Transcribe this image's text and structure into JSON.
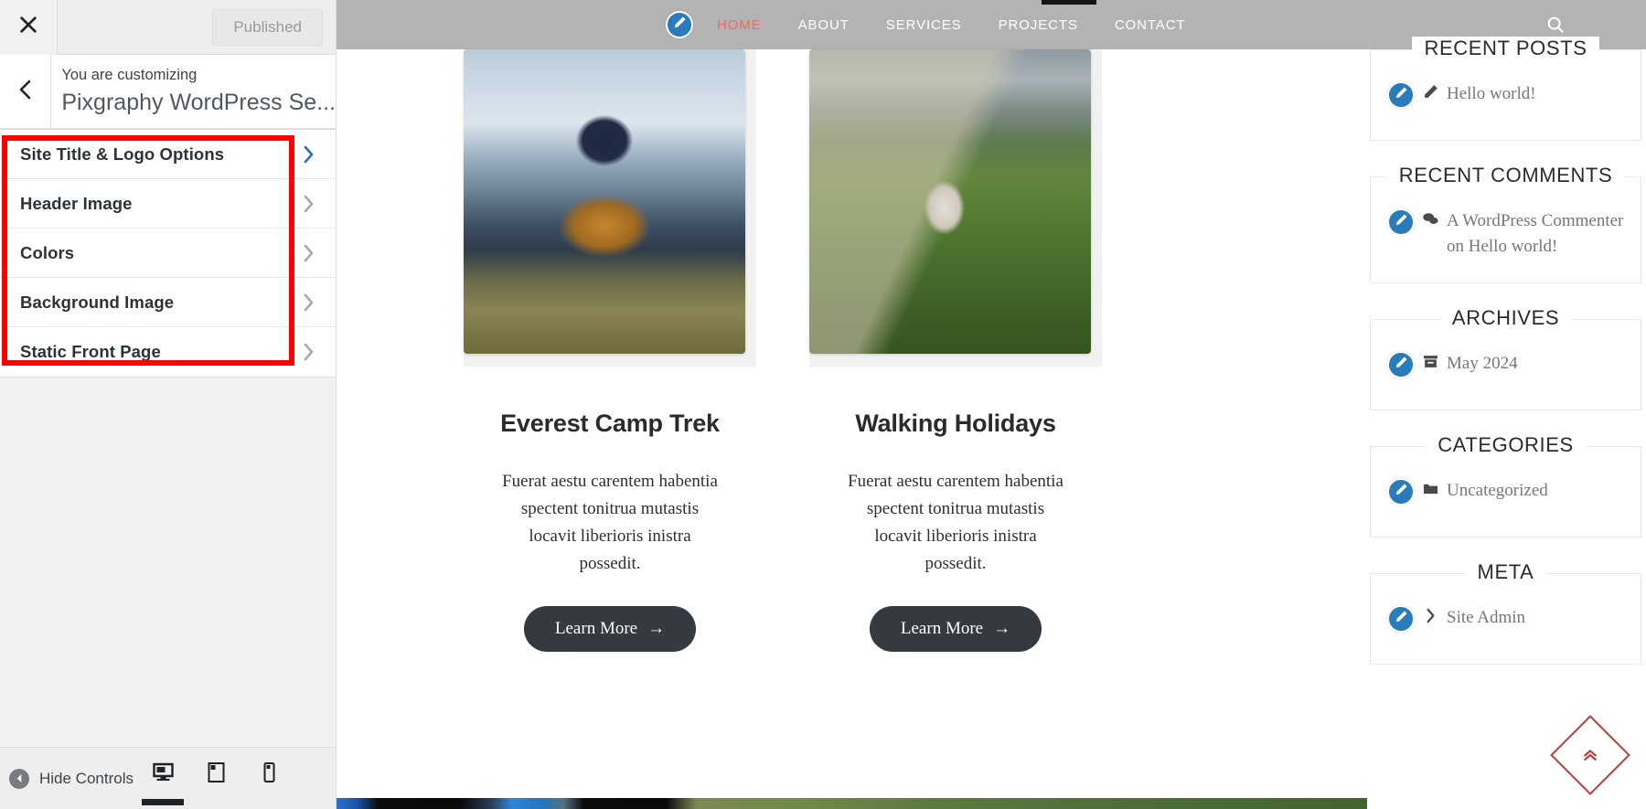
{
  "customizer": {
    "close_icon": "close-icon",
    "publish_label": "Published",
    "back_icon": "chevron-left-icon",
    "kicker": "You are customizing",
    "site_title": "Pixgraphy WordPress Se...",
    "menu_items": [
      {
        "label": "Site Title & Logo Options",
        "accent": true
      },
      {
        "label": "Header Image",
        "accent": false
      },
      {
        "label": "Colors",
        "accent": false
      },
      {
        "label": "Background Image",
        "accent": false
      },
      {
        "label": "Static Front Page",
        "accent": false
      }
    ],
    "highlight_color": "#fe0000",
    "footer": {
      "hide_controls_label": "Hide Controls",
      "devices": [
        {
          "name": "desktop",
          "active": true
        },
        {
          "name": "tablet",
          "active": false
        },
        {
          "name": "mobile",
          "active": false
        }
      ]
    }
  },
  "preview": {
    "header": {
      "nav": [
        {
          "label": "HOME",
          "current": true
        },
        {
          "label": "ABOUT",
          "current": false
        },
        {
          "label": "SERVICES",
          "current": false
        },
        {
          "label": "PROJECTS",
          "current": false
        },
        {
          "label": "CONTACT",
          "current": false
        }
      ],
      "active_color": "#ef6b63",
      "bg_color": "#b3b3b3",
      "search_icon": "search-icon",
      "edit_icon": "pencil-edit-icon"
    },
    "cards": [
      {
        "title": "Everest Camp Trek",
        "text": "Fuerat aestu carentem habentia spectent tonitrua mutastis locavit liberioris inistra possedit.",
        "button_label": "Learn More",
        "button_arrow": "→",
        "image_alt": "hiker-with-orange-backpack-in-mountains"
      },
      {
        "title": "Walking Holidays",
        "text": "Fuerat aestu carentem habentia spectent tonitrua mutastis locavit liberioris inistra possedit.",
        "button_label": "Learn More",
        "button_arrow": "→",
        "image_alt": "woman-walking-on-green-ridge-trail"
      }
    ],
    "widgets": [
      {
        "title": "RECENT POSTS",
        "icon": "pencil-icon",
        "rows": [
          {
            "text": "Hello world!"
          }
        ]
      },
      {
        "title": "RECENT COMMENTS",
        "icon": "comments-icon",
        "rows": [
          {
            "text": "A WordPress Commenter on Hello world!"
          }
        ]
      },
      {
        "title": "ARCHIVES",
        "icon": "archive-box-icon",
        "rows": [
          {
            "text": "May 2024"
          }
        ]
      },
      {
        "title": "CATEGORIES",
        "icon": "folder-icon",
        "rows": [
          {
            "text": "Uncategorized"
          }
        ]
      },
      {
        "title": "META",
        "icon": "chevron-right-icon",
        "rows": [
          {
            "text": "Site Admin"
          }
        ]
      }
    ],
    "scroll_top": {
      "icon": "double-chevron-up-icon",
      "color": "#b5413f"
    }
  }
}
